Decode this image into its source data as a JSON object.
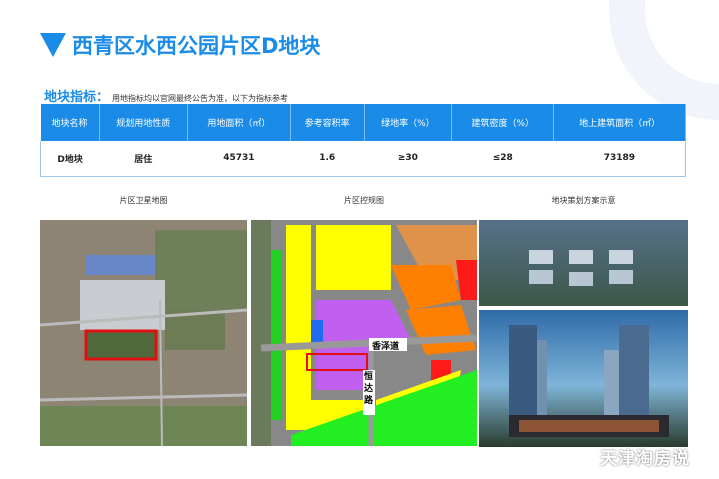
{
  "title": "西青区水西公园片区D地块",
  "subtitle": {
    "label": "地块指标：",
    "note": "用地指标均以官网最终公告为准，以下为指标参考"
  },
  "table": {
    "headers": [
      "地块名称",
      "规划用地性质",
      "用地面积（㎡）",
      "参考容积率",
      "绿地率（%）",
      "建筑密度（%）",
      "地上建筑面积（㎡）"
    ],
    "rows": [
      [
        "D地块",
        "居住",
        "45731",
        "1.6",
        "≥30",
        "≤28",
        "73189"
      ]
    ]
  },
  "captions": {
    "satellite": "片区卫星地图",
    "zoning": "片区控规图",
    "render": "地块策划方案示意"
  },
  "map_labels": {
    "road1": "香泽道",
    "road2": "恒达路"
  },
  "watermark": "天津淘房说",
  "colors": {
    "accent": "#1a8ce8",
    "highlight": "#e01010"
  }
}
